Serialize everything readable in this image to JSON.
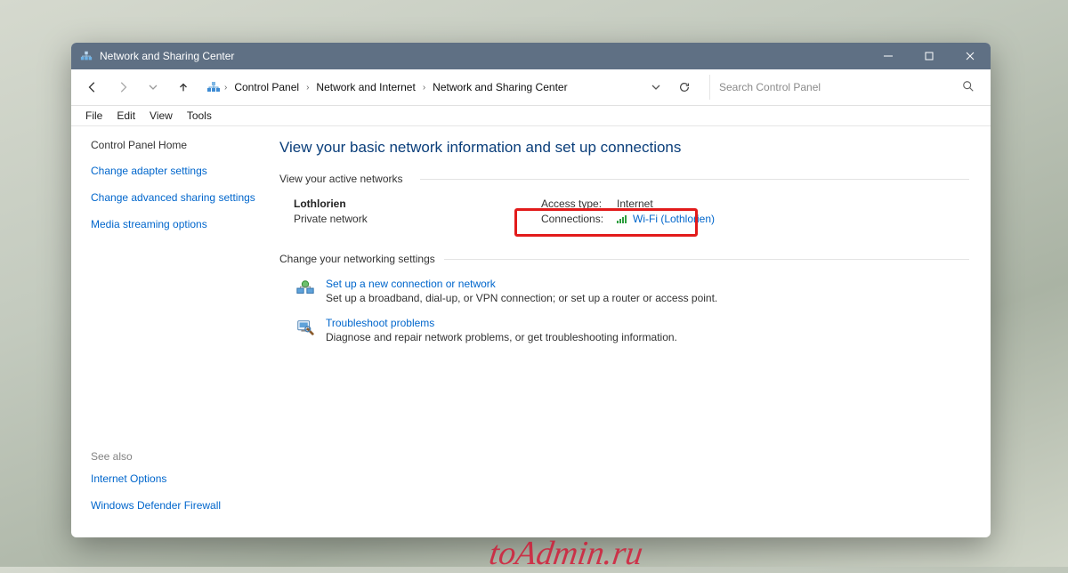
{
  "window": {
    "title": "Network and Sharing Center"
  },
  "breadcrumb": {
    "items": [
      "Control Panel",
      "Network and Internet",
      "Network and Sharing Center"
    ]
  },
  "search": {
    "placeholder": "Search Control Panel"
  },
  "menu": {
    "file": "File",
    "edit": "Edit",
    "view": "View",
    "tools": "Tools"
  },
  "sidebar": {
    "home": "Control Panel Home",
    "links": [
      "Change adapter settings",
      "Change advanced sharing settings",
      "Media streaming options"
    ],
    "see_also_label": "See also",
    "see_also": [
      "Internet Options",
      "Windows Defender Firewall"
    ]
  },
  "page": {
    "heading": "View your basic network information and set up connections",
    "active_label": "View your active networks",
    "network": {
      "name": "Lothlorien",
      "type": "Private network",
      "access_label": "Access type:",
      "access_value": "Internet",
      "conn_label": "Connections:",
      "conn_link": "Wi-Fi (Lothlorien)"
    },
    "change_label": "Change your networking settings",
    "tasks": [
      {
        "title": "Set up a new connection or network",
        "desc": "Set up a broadband, dial-up, or VPN connection; or set up a router or access point."
      },
      {
        "title": "Troubleshoot problems",
        "desc": "Diagnose and repair network problems, or get troubleshooting information."
      }
    ]
  },
  "watermark": "toAdmin.ru"
}
